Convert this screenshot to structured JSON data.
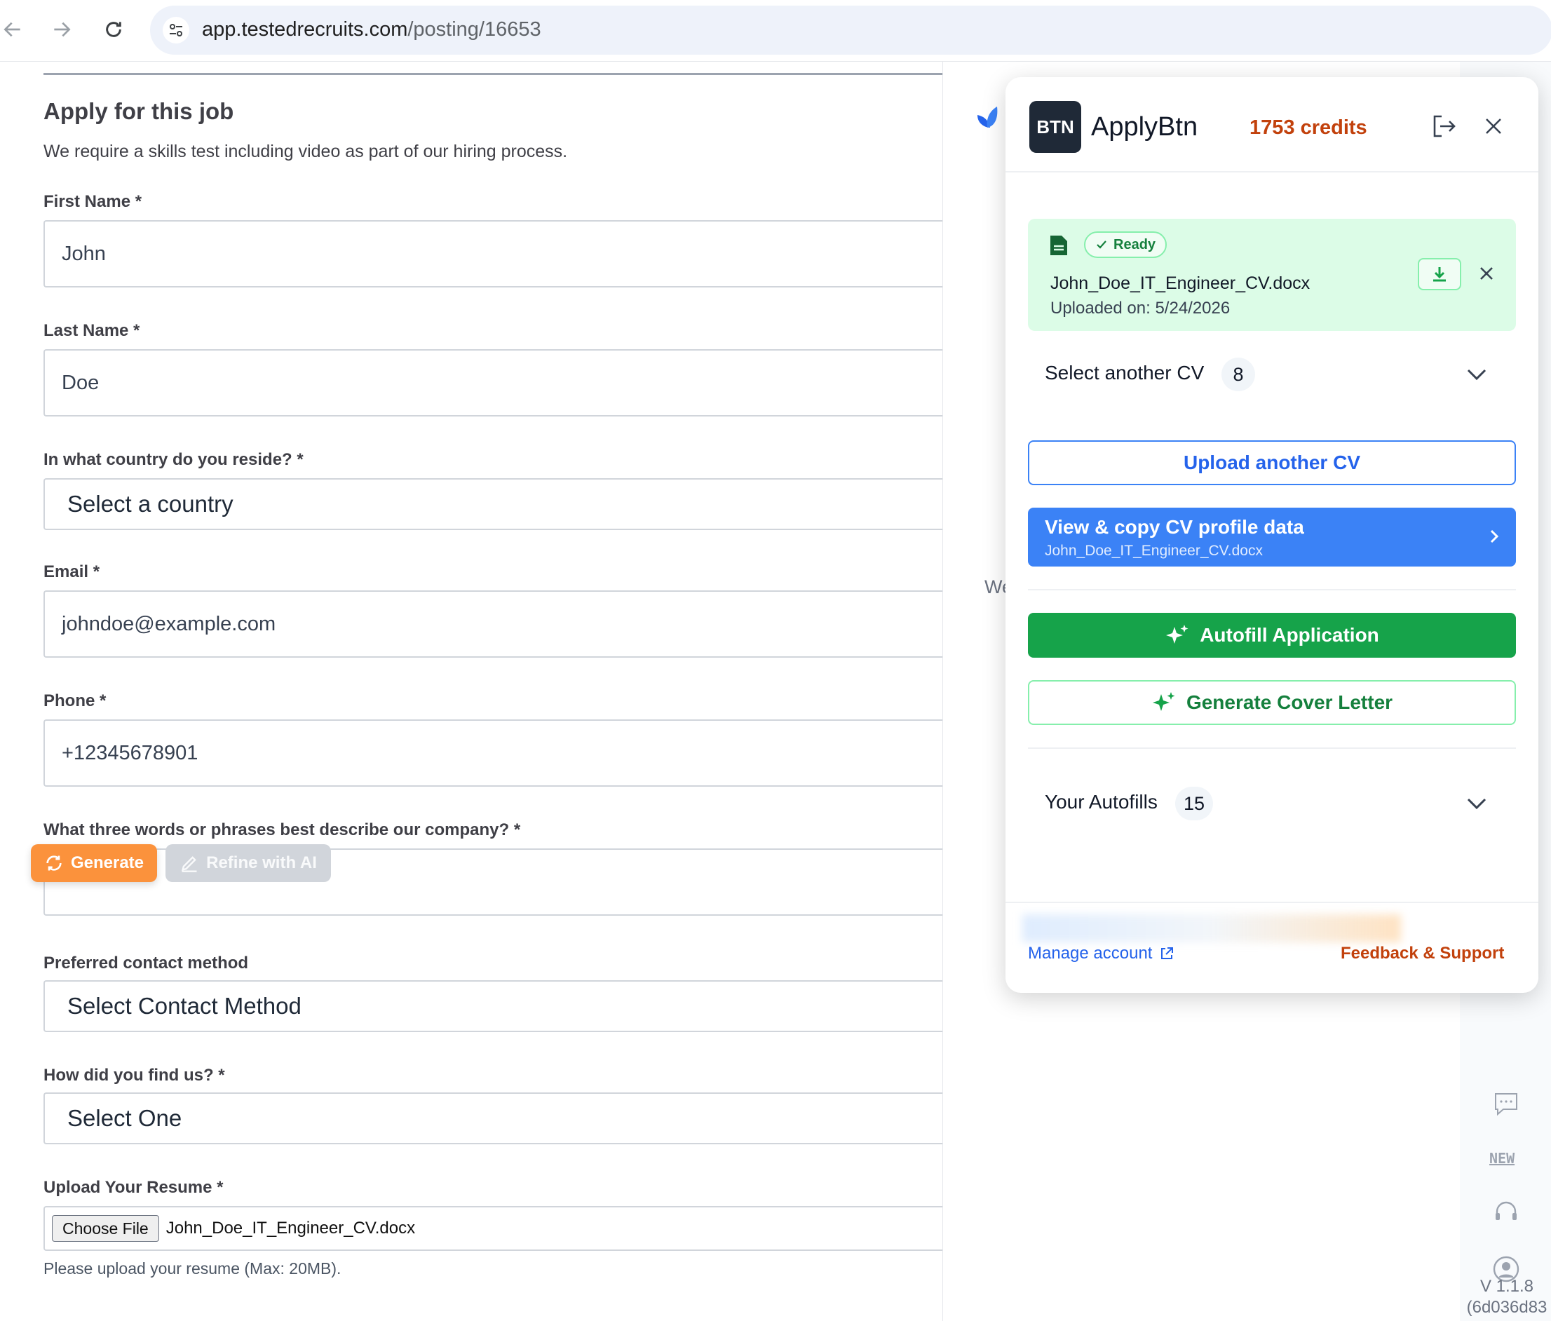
{
  "browser": {
    "url_host": "app.testedrecruits.com",
    "url_path": "/posting/16653"
  },
  "form": {
    "title": "Apply for this job",
    "intro": "We require a skills test including video as part of our hiring process.",
    "first_name": {
      "label": "First Name *",
      "value": "John"
    },
    "last_name": {
      "label": "Last Name *",
      "value": "Doe"
    },
    "country": {
      "label": "In what country do you reside? *",
      "value": "Select a country"
    },
    "email": {
      "label": "Email *",
      "value": "johndoe@example.com"
    },
    "phone": {
      "label": "Phone *",
      "value": "+12345678901"
    },
    "three_words": {
      "label": "What three words or phrases best describe our company? *",
      "value": ""
    },
    "generate_label": "Generate",
    "refine_label": "Refine with AI",
    "contact": {
      "label": "Preferred contact method",
      "value": "Select Contact Method"
    },
    "found": {
      "label": "How did you find us? *",
      "value": "Select One"
    },
    "resume": {
      "label": "Upload Your Resume *",
      "choose_label": "Choose File",
      "file_name": "John_Doe_IT_Engineer_CV.docx",
      "hint": "Please upload your resume (Max: 20MB)."
    }
  },
  "background": {
    "we_peek": "We",
    "version_line1": "V 1.1.8",
    "version_line2": "(6d036d83"
  },
  "panel": {
    "logo_text": "BTN",
    "brand": "ApplyBtn",
    "credits": "1753 credits",
    "cv": {
      "status": "Ready",
      "file_name": "John_Doe_IT_Engineer_CV.docx",
      "uploaded": "Uploaded on: 5/24/2026"
    },
    "select_cv": {
      "label": "Select another CV",
      "count": "8"
    },
    "upload_label": "Upload another CV",
    "view_copy": {
      "title": "View & copy CV profile data",
      "subtitle": "John_Doe_IT_Engineer_CV.docx"
    },
    "autofill_label": "Autofill Application",
    "cover_letter_label": "Generate Cover Letter",
    "your_autofills": {
      "label": "Your Autofills",
      "count": "15"
    },
    "footer": {
      "manage_label": "Manage account",
      "feedback_label": "Feedback & Support"
    }
  },
  "colors": {
    "accent_blue": "#3b82f6",
    "accent_green": "#16a34a",
    "credits_orange": "#c2410c",
    "generate_orange": "#fb923c",
    "ready_bg": "#dcfce7"
  }
}
